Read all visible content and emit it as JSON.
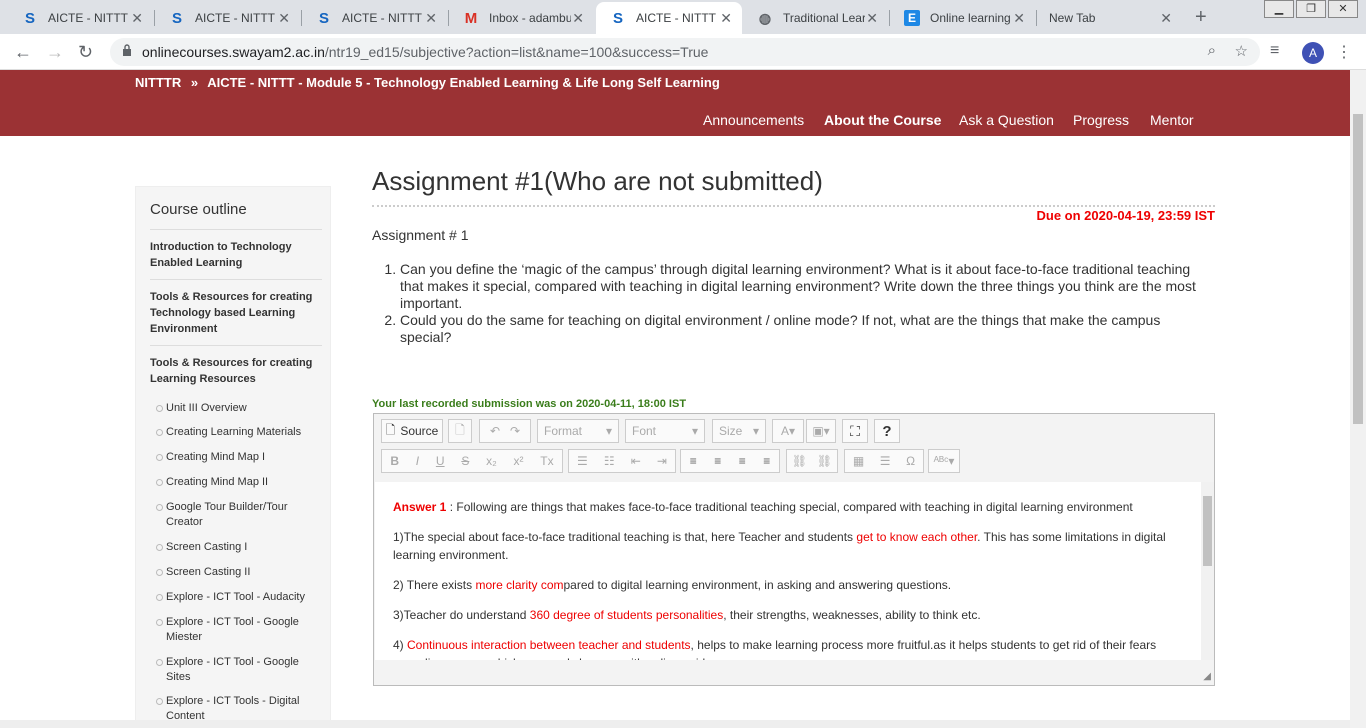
{
  "tabs": [
    {
      "label": "AICTE - NITTT -",
      "icon": "S",
      "active": false
    },
    {
      "label": "AICTE - NITTT -",
      "icon": "S",
      "active": false
    },
    {
      "label": "AICTE - NITTT -",
      "icon": "S",
      "active": false
    },
    {
      "label": "Inbox - adambur",
      "icon": "M",
      "active": false
    },
    {
      "label": "AICTE - NITTT -",
      "icon": "S",
      "active": true
    },
    {
      "label": "Traditional Learn",
      "icon": "globe",
      "active": false
    },
    {
      "label": "Online learning v",
      "icon": "E",
      "active": false
    },
    {
      "label": "New Tab",
      "icon": "",
      "active": false
    }
  ],
  "address": {
    "host": "onlinecourses.swayam2.ac.in",
    "path": "/ntr19_ed15/subjective?action=list&name=100&success=True"
  },
  "profile_initial": "A",
  "header": {
    "breadcrumb_root": "NITTTR",
    "breadcrumb_sep": "»",
    "breadcrumb_course": "AICTE - NITTT - Module 5 - Technology Enabled Learning & Life Long Self Learning",
    "nav": [
      "Announcements",
      "About the Course",
      "Ask a Question",
      "Progress",
      "Mentor"
    ],
    "active_nav": "About the Course"
  },
  "sidebar": {
    "title": "Course outline",
    "units": [
      "Introduction to Technology Enabled Learning",
      "Tools & Resources for creating Technology based Learning Environment",
      "Tools & Resources for creating Learning Resources"
    ],
    "items": [
      "Unit III Overview",
      "Creating Learning Materials",
      "Creating Mind Map I",
      "Creating Mind Map II",
      "Google Tour Builder/Tour Creator",
      "Screen Casting I",
      "Screen Casting II",
      "Explore - ICT Tool - Audacity",
      "Explore - ICT Tool - Google Miester",
      "Explore - ICT Tool - Google Sites",
      "Explore - ICT Tools - Digital Content"
    ]
  },
  "assignment": {
    "title": "Assignment #1(Who are not submitted)",
    "due": "Due on 2020-04-19, 23:59 IST",
    "label": "Assignment # 1",
    "questions": [
      "Can you define the ‘magic of the campus’ through digital learning environment? What is it about face-to-face traditional teaching that makes it special, compared with teaching in digital learning environment? Write down the three things you think are the most important.",
      "Could you do the same for teaching on digital environment / online mode? If not, what are the things that make the campus special?"
    ],
    "submission": "Your last recorded submission was on 2020-04-11, 18:00 IST"
  },
  "editor": {
    "source_label": "Source",
    "format_label": "Format",
    "font_label": "Font",
    "size_label": "Size",
    "answer_heading": "Answer 1",
    "answer_intro": " : Following are things that makes face-to-face traditional teaching special, compared with teaching in digital learning environment",
    "p1_a": "1)The special about face-to-face traditional teaching is that, here Teacher and students ",
    "p1_red": "get to know each other",
    "p1_b": ". This has some limitations in digital learning environment.",
    "p2_a": "2) There exists ",
    "p2_red": "more clarity com",
    "p2_b": "pared to digital learning environment, in asking and answering questions.",
    "p3_a": "3)Teacher do understand ",
    "p3_red": "360 degree of students personalities",
    "p3_b": ", their strengths, weaknesses, ability to think etc.",
    "p4_a": "4) ",
    "p4_red": "Continuous interaction between teacher and students",
    "p4_b": ", helps to make learning process more fruitful.as it helps students to get rid of their fears regarding exams, which can rarely happen with online guidance."
  }
}
